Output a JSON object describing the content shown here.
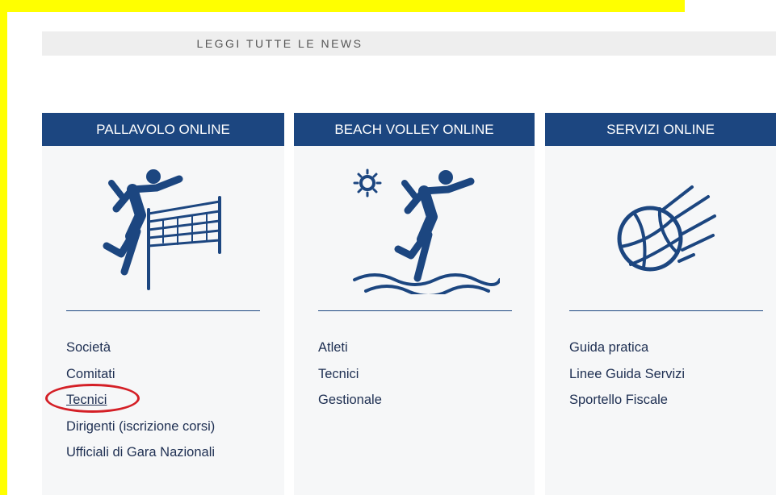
{
  "news": {
    "read_all_label": "LEGGI TUTTE LE NEWS"
  },
  "cards": [
    {
      "title": "PALLAVOLO ONLINE",
      "icon": "volleyball-player-net-icon",
      "links": [
        "Società",
        "Comitati",
        "Tecnici",
        "Dirigenti (iscrizione corsi)",
        "Ufficiali di Gara Nazionali"
      ]
    },
    {
      "title": "BEACH VOLLEY ONLINE",
      "icon": "beach-volley-player-sun-icon",
      "links": [
        "Atleti",
        "Tecnici",
        "Gestionale"
      ]
    },
    {
      "title": "SERVIZI ONLINE",
      "icon": "flying-volleyball-icon",
      "links": [
        "Guida pratica",
        "Linee Guida Servizi",
        "Sportello Fiscale"
      ]
    }
  ],
  "colors": {
    "highlight": "#ffff00",
    "header_bg": "#1c4680",
    "card_bg": "#f6f7f8",
    "link_text": "#1e2f52",
    "annotation_circle": "#d41f26"
  }
}
